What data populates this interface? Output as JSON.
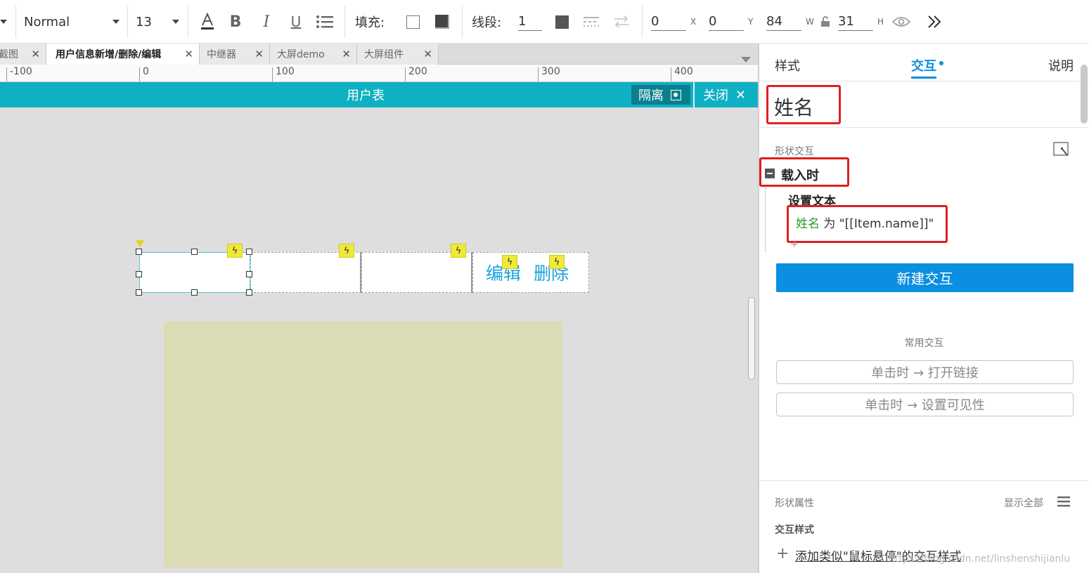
{
  "toolbar": {
    "style_select": "Normal",
    "font_size": "13",
    "fill_label": "填充:",
    "line_label": "线段:",
    "line_value": "1",
    "x_value": "0",
    "x_label": "X",
    "y_value": "0",
    "y_label": "Y",
    "w_value": "84",
    "w_label": "W",
    "h_value": "31",
    "h_label": "H"
  },
  "tabs": [
    {
      "label": "截图",
      "active": false
    },
    {
      "label": "用户信息新增/删除/编辑",
      "active": true
    },
    {
      "label": "中继器",
      "active": false
    },
    {
      "label": "大屏demo",
      "active": false
    },
    {
      "label": "大屏组件",
      "active": false
    }
  ],
  "ruler": [
    "-100",
    "0",
    "100",
    "200",
    "300",
    "400"
  ],
  "titlebar": {
    "title": "用户表",
    "isolate_label": "隔离",
    "close_label": "关闭"
  },
  "canvas": {
    "edit_link": "编辑",
    "delete_link": "删除"
  },
  "panel": {
    "tabs": [
      "样式",
      "交互",
      "说明"
    ],
    "active_tab": "交互",
    "shape_name": "姓名",
    "section_shape_interaction": "形状交互",
    "event_name": "载入时",
    "action_title": "设置文本",
    "action_target": "姓名",
    "action_rest": " 为 \"[[Item.name]]\"",
    "new_interaction": "新建交互",
    "common_interactions_title": "常用交互",
    "common_interactions": [
      "单击时 → 打开链接",
      "单击时 → 设置可见性"
    ],
    "shape_props_title": "形状属性",
    "show_all": "显示全部",
    "interaction_style_title": "交互样式",
    "add_style_link": "添加类似\"鼠标悬停\"的交互样式",
    "watermark": "https://blog.csdn.net/linshenshijianlu"
  },
  "colors": {
    "accent_blue": "#0b8fe0",
    "titlebar_teal": "#0fb0c3",
    "highlight_red": "#e02020",
    "link_cyan": "#1aa3d9",
    "bolt_yellow": "#f1e93a"
  }
}
